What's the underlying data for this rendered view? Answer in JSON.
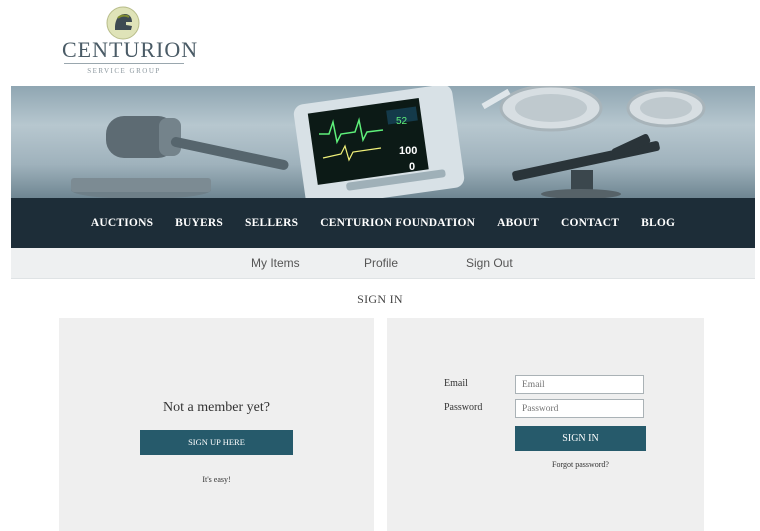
{
  "logo": {
    "name": "CENTURION",
    "subtitle": "SERVICE GROUP"
  },
  "nav": {
    "items": [
      "AUCTIONS",
      "BUYERS",
      "SELLERS",
      "CENTURION FOUNDATION",
      "ABOUT",
      "CONTACT",
      "BLOG"
    ]
  },
  "subnav": {
    "items": [
      "My Items",
      "Profile",
      "Sign Out"
    ]
  },
  "monitor": {
    "readouts": [
      "52",
      "100",
      "0"
    ]
  },
  "page": {
    "heading": "SIGN IN"
  },
  "signup": {
    "prompt": "Not a member yet?",
    "button": "SIGN UP HERE",
    "note": "It's easy!"
  },
  "signin": {
    "email_label": "Email",
    "email_placeholder": "Email",
    "password_label": "Password",
    "password_placeholder": "Password",
    "button": "SIGN IN",
    "forgot": "Forgot password?"
  },
  "colors": {
    "nav_bg": "#1d2d38",
    "button_bg": "#265a6b",
    "panel_bg": "#efefef",
    "subnav_bg": "#eef0f1"
  }
}
